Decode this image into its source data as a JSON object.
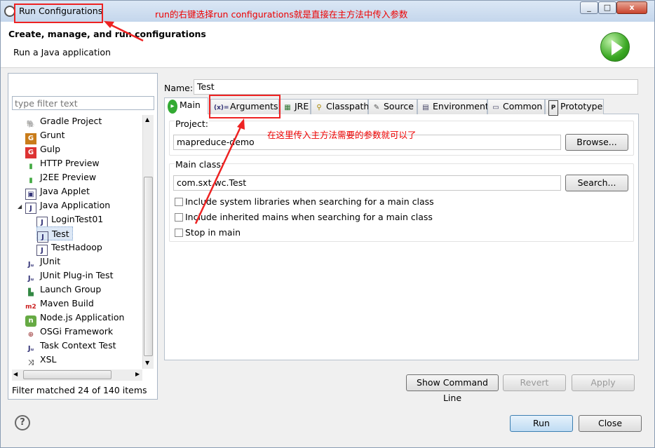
{
  "window": {
    "title": "Run Configurations",
    "controls": [
      "_",
      "□",
      "x"
    ]
  },
  "header": {
    "title": "Create, manage, and run configurations",
    "subtitle": "Run a Java application"
  },
  "left": {
    "filter_placeholder": "type filter text",
    "tree": [
      {
        "label": "Gradle Project",
        "icon": "gradle-icon",
        "indent": 0
      },
      {
        "label": "Grunt",
        "icon": "grunt-icon",
        "indent": 0
      },
      {
        "label": "Gulp",
        "icon": "gulp-icon",
        "indent": 0
      },
      {
        "label": "HTTP Preview",
        "icon": "http-preview-icon",
        "indent": 0
      },
      {
        "label": "J2EE Preview",
        "icon": "j2ee-preview-icon",
        "indent": 0
      },
      {
        "label": "Java Applet",
        "icon": "java-applet-icon",
        "indent": 0
      },
      {
        "label": "Java Application",
        "icon": "java-application-icon",
        "indent": 0,
        "expanded": true
      },
      {
        "label": "LoginTest01",
        "icon": "java-class-icon",
        "indent": 1
      },
      {
        "label": "Test",
        "icon": "java-class-icon",
        "indent": 1,
        "selected": true
      },
      {
        "label": "TestHadoop",
        "icon": "java-class-icon",
        "indent": 1
      },
      {
        "label": "JUnit",
        "icon": "junit-icon",
        "indent": 0
      },
      {
        "label": "JUnit Plug-in Test",
        "icon": "junit-plugin-icon",
        "indent": 0
      },
      {
        "label": "Launch Group",
        "icon": "launch-group-icon",
        "indent": 0
      },
      {
        "label": "Maven Build",
        "icon": "maven-icon",
        "indent": 0
      },
      {
        "label": "Node.js Application",
        "icon": "nodejs-icon",
        "indent": 0
      },
      {
        "label": "OSGi Framework",
        "icon": "osgi-icon",
        "indent": 0
      },
      {
        "label": "Task Context Test",
        "icon": "task-context-icon",
        "indent": 0
      },
      {
        "label": "XSL",
        "icon": "xsl-icon",
        "indent": 0
      }
    ],
    "status": "Filter matched 24 of 140 items"
  },
  "config": {
    "name_label": "Name:",
    "name_value": "Test",
    "tabs": [
      {
        "label": "Main",
        "icon": "main-tab-icon",
        "active": true
      },
      {
        "label": "Arguments",
        "icon": "arguments-tab-icon"
      },
      {
        "label": "JRE",
        "icon": "jre-tab-icon"
      },
      {
        "label": "Classpath",
        "icon": "classpath-tab-icon"
      },
      {
        "label": "Source",
        "icon": "source-tab-icon"
      },
      {
        "label": "Environment",
        "icon": "environment-tab-icon"
      },
      {
        "label": "Common",
        "icon": "common-tab-icon"
      },
      {
        "label": "Prototype",
        "icon": "prototype-tab-icon"
      }
    ],
    "project_label": "Project:",
    "project_value": "mapreduce-demo",
    "browse_label": "Browse...",
    "main_class_label": "Main class:",
    "main_class_value": "com.sxt.wc.Test",
    "search_label": "Search...",
    "checkboxes": [
      {
        "label": "Include system libraries when searching for a main class",
        "checked": false
      },
      {
        "label": "Include inherited mains when searching for a main class",
        "checked": false
      },
      {
        "label": "Stop in main",
        "checked": false
      }
    ],
    "show_command_line_label": "Show Command Line",
    "revert_label": "Revert",
    "apply_label": "Apply"
  },
  "footer": {
    "run_label": "Run",
    "close_label": "Close"
  },
  "annotations": {
    "top": "run的右键选择run configurations就是直接在主方法中传入参数",
    "middle": "在这里传入主方法需要的参数就可以了"
  }
}
